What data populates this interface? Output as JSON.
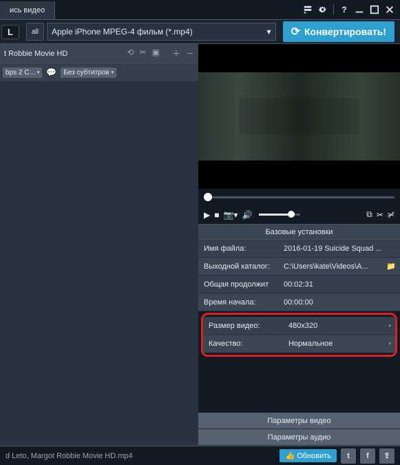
{
  "tab": {
    "label": "ись видео"
  },
  "toolbar": {
    "pill": "L",
    "preset": "Apple iPhone MPEG-4 фильм (*.mp4)",
    "convert": "Конвертировать!"
  },
  "file": {
    "name": "t Robbie Movie HD",
    "sub1": "bps 2 С...",
    "sub2": "Без субтитров"
  },
  "settings": {
    "title": "Базовые установки",
    "rows": {
      "filename_label": "Имя файла:",
      "filename_value": "2016-01-19 Suicide Squad ...",
      "outdir_label": "Выходной каталог:",
      "outdir_value": "C:\\Users\\kate\\Videos\\A...",
      "duration_label": "Общая продолжит",
      "duration_value": "00:02:31",
      "start_label": "Время начала:",
      "start_value": "00:00:00",
      "size_label": "Размер видео:",
      "size_value": "480x320",
      "quality_label": "Качество:",
      "quality_value": "Нормальное"
    },
    "video_params": "Параметры видео",
    "audio_params": "Параметры аудио"
  },
  "footer": {
    "filename": "d Leto, Margot Robbie Movie HD.mp4",
    "refresh": "Обновить"
  }
}
